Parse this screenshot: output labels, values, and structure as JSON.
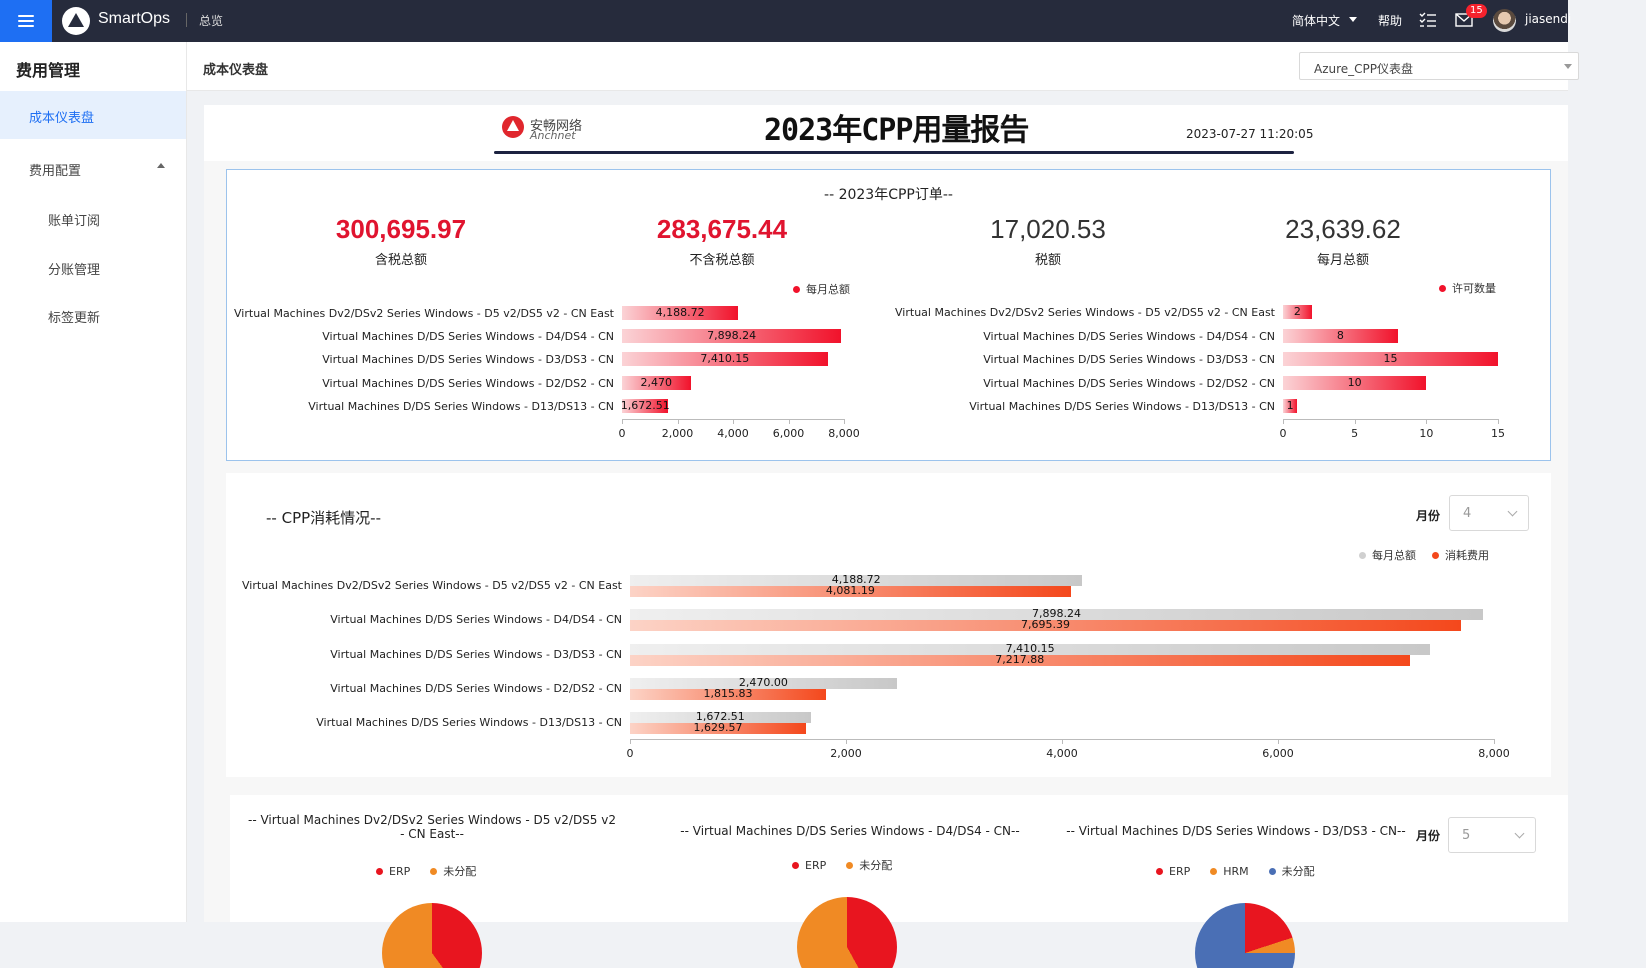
{
  "topbar": {
    "brand": "SmartOps",
    "breadcrumb": "总览",
    "language": "简体中文",
    "help": "帮助",
    "mail_count": "15",
    "username": "jiasendi",
    "accent": "#1e6ff3"
  },
  "sidebar": {
    "title": "费用管理",
    "items": [
      {
        "label": "成本仪表盘",
        "active": true
      },
      {
        "label": "费用配置"
      },
      {
        "label": "账单订阅"
      },
      {
        "label": "分账管理"
      },
      {
        "label": "标签更新"
      }
    ]
  },
  "page": {
    "title": "成本仪表盘",
    "dashboard_select": "Azure_CPP仪表盘"
  },
  "report": {
    "logo_cn": "安畅网络",
    "logo_en": "Anchnet",
    "title": "2023年CPP用量报告",
    "timestamp": "2023-07-27 11:20:05"
  },
  "orders": {
    "title": "-- 2023年CPP订单--",
    "kpis": [
      {
        "value": "300,695.97",
        "label": "含税总额"
      },
      {
        "value": "283,675.44",
        "label": "不含税总额"
      },
      {
        "value": "17,020.53",
        "label": "税额"
      },
      {
        "value": "23,639.62",
        "label": "每月总额"
      }
    ]
  },
  "consumption": {
    "title": "-- CPP消耗情况--",
    "month_label": "月份",
    "month_value": "4"
  },
  "pies": {
    "month_label": "月份",
    "month_value": "5",
    "titles": [
      "-- Virtual Machines Dv2/DSv2 Series Windows - D5 v2/DS5 v2 - CN East--",
      "-- Virtual Machines D/DS Series Windows - D4/DS4 - CN--",
      "-- Virtual Machines D/DS Series Windows - D3/DS3 - CN--"
    ],
    "legends": [
      [
        {
          "name": "ERP",
          "color": "#e8151f"
        },
        {
          "name": "未分配",
          "color": "#f08a24"
        }
      ],
      [
        {
          "name": "ERP",
          "color": "#e8151f"
        },
        {
          "name": "未分配",
          "color": "#f08a24"
        }
      ],
      [
        {
          "name": "ERP",
          "color": "#e8151f"
        },
        {
          "name": "HRM",
          "color": "#f08a24"
        },
        {
          "name": "未分配",
          "color": "#4a6fb5"
        }
      ]
    ]
  },
  "chart_data": [
    {
      "type": "bar",
      "orientation": "horizontal",
      "categories": [
        "Virtual Machines Dv2/DSv2 Series Windows - D5 v2/DS5 v2 - CN East",
        "Virtual Machines D/DS Series Windows - D4/DS4 - CN",
        "Virtual Machines D/DS Series Windows - D3/DS3 - CN",
        "Virtual Machines D/DS Series Windows - D2/DS2 - CN",
        "Virtual Machines D/DS Series Windows - D13/DS13 - CN"
      ],
      "series": [
        {
          "name": "每月总额",
          "values": [
            4188.72,
            7898.24,
            7410.15,
            2470,
            1672.51
          ],
          "labels": [
            "4,188.72",
            "7,898.24",
            "7,410.15",
            "2,470",
            "1,672.51"
          ],
          "color": "#f1122b"
        }
      ],
      "xlim": [
        0,
        8000
      ],
      "xticks": [
        "0",
        "2,000",
        "4,000",
        "6,000",
        "8,000"
      ],
      "legend": "top-right"
    },
    {
      "type": "bar",
      "orientation": "horizontal",
      "categories": [
        "Virtual Machines Dv2/DSv2 Series Windows - D5 v2/DS5 v2 - CN East",
        "Virtual Machines D/DS Series Windows - D4/DS4 - CN",
        "Virtual Machines D/DS Series Windows - D3/DS3 - CN",
        "Virtual Machines D/DS Series Windows - D2/DS2 - CN",
        "Virtual Machines D/DS Series Windows - D13/DS13 - CN"
      ],
      "series": [
        {
          "name": "许可数量",
          "values": [
            2,
            8,
            15,
            10,
            1
          ],
          "labels": [
            "2",
            "8",
            "15",
            "10",
            "1"
          ],
          "color": "#f1122b"
        }
      ],
      "xlim": [
        0,
        15
      ],
      "xticks": [
        "0",
        "5",
        "10",
        "15"
      ],
      "legend": "top-right"
    },
    {
      "type": "bar",
      "orientation": "horizontal",
      "categories": [
        "Virtual Machines Dv2/DSv2 Series Windows - D5 v2/DS5 v2 - CN East",
        "Virtual Machines D/DS Series Windows - D4/DS4 - CN",
        "Virtual Machines D/DS Series Windows - D3/DS3 - CN",
        "Virtual Machines D/DS Series Windows - D2/DS2 - CN",
        "Virtual Machines D/DS Series Windows - D13/DS13 - CN"
      ],
      "series": [
        {
          "name": "每月总额",
          "values": [
            4188.72,
            7898.24,
            7410.15,
            2470.0,
            1672.51
          ],
          "labels": [
            "4,188.72",
            "7,898.24",
            "7,410.15",
            "2,470.00",
            "1,672.51"
          ],
          "color": "#c8c8c8"
        },
        {
          "name": "消耗费用",
          "values": [
            4081.19,
            7695.39,
            7217.88,
            1815.83,
            1629.57
          ],
          "labels": [
            "4,081.19",
            "7,695.39",
            "7,217.88",
            "1,815.83",
            "1,629.57"
          ],
          "color": "#f4481c"
        }
      ],
      "xlim": [
        0,
        8000
      ],
      "xticks": [
        "0",
        "2,000",
        "4,000",
        "6,000",
        "8,000"
      ],
      "legend": "top-right"
    }
  ]
}
